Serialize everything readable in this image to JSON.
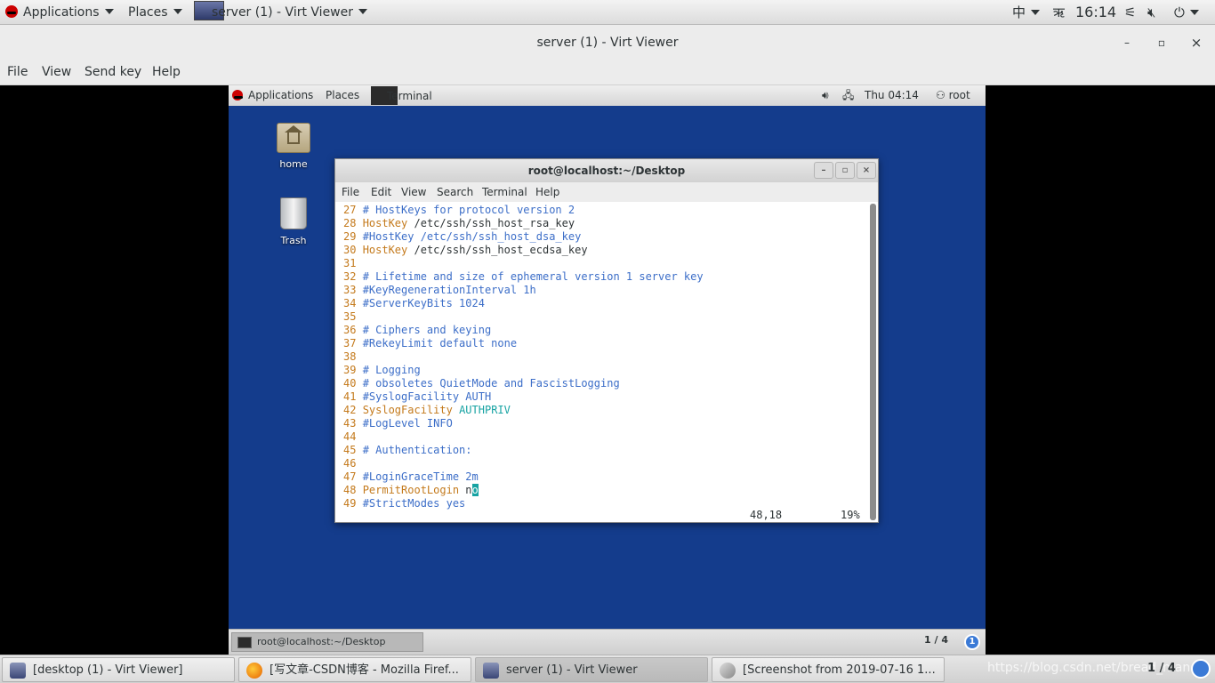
{
  "host_panel": {
    "applications": "Applications",
    "places": "Places",
    "window_task": "server (1) - Virt Viewer",
    "input_method": "中",
    "keyboard": "ऋ",
    "time": "16:14"
  },
  "virt_viewer": {
    "title": "server (1) - Virt Viewer",
    "minimize": "–",
    "maximize": "▫",
    "close": "×",
    "menu": [
      "File",
      "View",
      "Send key",
      "Help"
    ]
  },
  "guest_panel": {
    "applications": "Applications",
    "places": "Places",
    "terminal": "Terminal",
    "time": "Thu 04:14",
    "user": "root"
  },
  "desktop_icons": [
    {
      "label": "home"
    },
    {
      "label": "Trash"
    }
  ],
  "terminal": {
    "title": "root@localhost:~/Desktop",
    "menu": [
      "File",
      "Edit",
      "View",
      "Search",
      "Terminal",
      "Help"
    ],
    "lines": [
      {
        "n": "27",
        "kind": "comment",
        "text": "# HostKeys for protocol version 2"
      },
      {
        "n": "28",
        "kind": "kv",
        "key": "HostKey",
        "val": " /etc/ssh/ssh_host_rsa_key"
      },
      {
        "n": "29",
        "kind": "comment",
        "text": "#HostKey /etc/ssh/ssh_host_dsa_key"
      },
      {
        "n": "30",
        "kind": "kv",
        "key": "HostKey",
        "val": " /etc/ssh/ssh_host_ecdsa_key"
      },
      {
        "n": "31",
        "kind": "blank",
        "text": ""
      },
      {
        "n": "32",
        "kind": "comment",
        "text": "# Lifetime and size of ephemeral version 1 server key"
      },
      {
        "n": "33",
        "kind": "comment",
        "text": "#KeyRegenerationInterval 1h"
      },
      {
        "n": "34",
        "kind": "comment",
        "text": "#ServerKeyBits 1024"
      },
      {
        "n": "35",
        "kind": "blank",
        "text": ""
      },
      {
        "n": "36",
        "kind": "comment",
        "text": "# Ciphers and keying"
      },
      {
        "n": "37",
        "kind": "comment",
        "text": "#RekeyLimit default none"
      },
      {
        "n": "38",
        "kind": "blank",
        "text": ""
      },
      {
        "n": "39",
        "kind": "comment",
        "text": "# Logging"
      },
      {
        "n": "40",
        "kind": "comment",
        "text": "# obsoletes QuietMode and FascistLogging"
      },
      {
        "n": "41",
        "kind": "comment",
        "text": "#SyslogFacility AUTH"
      },
      {
        "n": "42",
        "kind": "kvv",
        "key": "SyslogFacility",
        "val": " AUTHPRIV"
      },
      {
        "n": "43",
        "kind": "comment",
        "text": "#LogLevel INFO"
      },
      {
        "n": "44",
        "kind": "blank",
        "text": ""
      },
      {
        "n": "45",
        "kind": "comment",
        "text": "# Authentication:"
      },
      {
        "n": "46",
        "kind": "blank",
        "text": ""
      },
      {
        "n": "47",
        "kind": "comment",
        "text": "#LoginGraceTime 2m"
      },
      {
        "n": "48",
        "kind": "cursor",
        "key": "PermitRootLogin",
        "pre": " n",
        "cur": "o"
      },
      {
        "n": "49",
        "kind": "comment",
        "text": "#StrictModes yes"
      }
    ],
    "status_pos": "48,18",
    "status_pct": "19%"
  },
  "guest_bottom": {
    "task": "root@localhost:~/Desktop",
    "workspace": "1 / 4",
    "badge": "1"
  },
  "host_bottom": {
    "tasks": [
      {
        "label": "[desktop (1) - Virt Viewer]",
        "icon": "monitor-icon"
      },
      {
        "label": "[写文章-CSDN博客 - Mozilla Firef...",
        "icon": "firefox-icon"
      },
      {
        "label": "server (1) - Virt Viewer",
        "icon": "monitor-icon"
      },
      {
        "label": "[Screenshot from 2019-07-16 1...",
        "icon": "image-viewer-icon"
      }
    ],
    "workspace": "1 / 4",
    "watermark": "https://blog.csdn.net/bread_man"
  }
}
